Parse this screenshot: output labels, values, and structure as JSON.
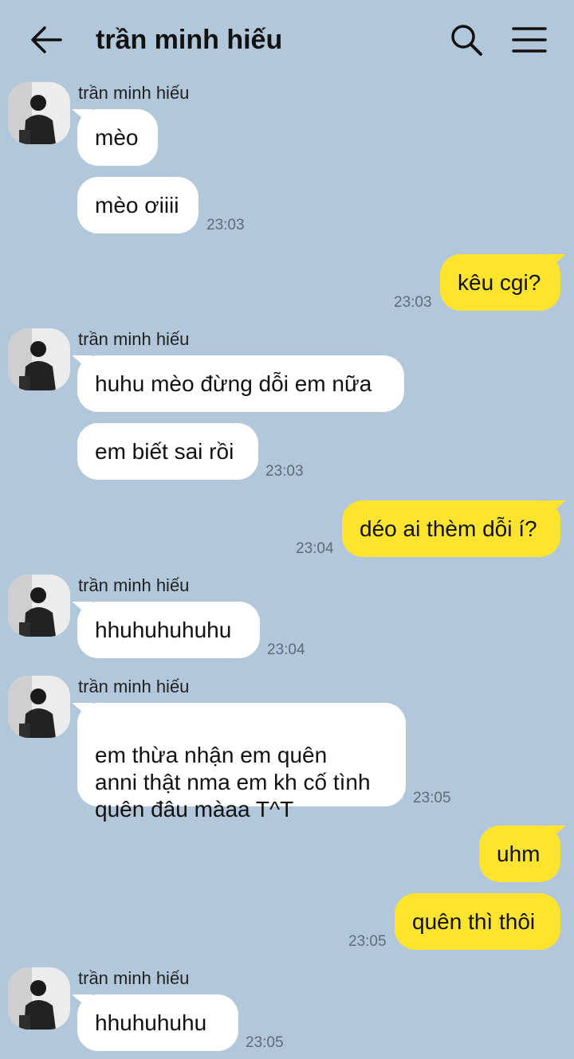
{
  "header": {
    "title": "trần minh hiếu",
    "back_icon": "arrow-left-icon",
    "search_icon": "search-icon",
    "menu_icon": "hamburger-menu-icon"
  },
  "colors": {
    "background": "#b2c7d9",
    "incoming_bubble": "#ffffff",
    "outgoing_bubble": "#fee42f"
  },
  "messages": [
    {
      "sender": "trần minh hiếu",
      "text": "mèo"
    },
    {
      "text": "mèo ơiiii",
      "time": "23:03"
    },
    {
      "text": "kêu cgi?",
      "time": "23:03"
    },
    {
      "sender": "trần minh hiếu",
      "text": "huhu mèo đừng dỗi em nữa"
    },
    {
      "text": "em biết sai rồi",
      "time": "23:03"
    },
    {
      "text": "déo ai thèm dỗi í?",
      "time": "23:04"
    },
    {
      "sender": "trần minh hiếu",
      "text": "hhuhuhuhuhu",
      "time": "23:04"
    },
    {
      "sender": "trần minh hiếu",
      "text": "em thừa nhận em quên\nanni thật nma em kh cố tình\nquên đâu màaa T^T",
      "time": "23:05"
    },
    {
      "text": "uhm"
    },
    {
      "text": "quên thì thôi",
      "time": "23:05"
    },
    {
      "sender": "trần minh hiếu",
      "text": "hhuhuhuhu",
      "time": "23:05"
    }
  ]
}
